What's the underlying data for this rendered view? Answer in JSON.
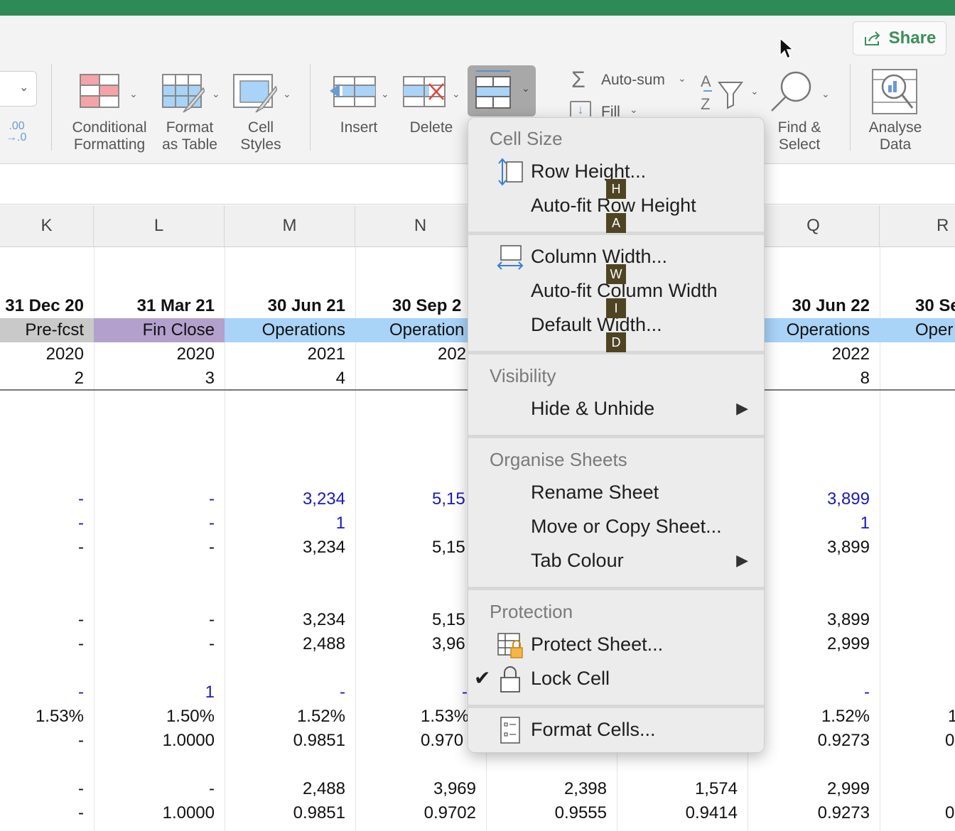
{
  "share": {
    "label": "Share"
  },
  "ribbon": {
    "decimal_label": ".00\n→.0",
    "conditional_formatting": "Conditional\nFormatting",
    "format_as_table": "Format\nas Table",
    "cell_styles": "Cell\nStyles",
    "insert": "Insert",
    "delete": "Delete",
    "autosum": "Auto-sum",
    "fill": "Fill",
    "find_select": "Find &\nSelect",
    "analyse_data": "Analyse\nData"
  },
  "columns": {
    "k": "K",
    "l": "L",
    "m": "M",
    "n": "N",
    "q": "Q",
    "r": "R"
  },
  "sheet": {
    "row_dates": [
      "31 Dec 20",
      "31 Mar 21",
      "30 Jun 21",
      "30 Sep 2",
      "30 Jun 22",
      "30 Se"
    ],
    "row_phase": [
      "Pre-fcst",
      "Fin Close",
      "Operations",
      "Operation",
      "Operations",
      "Oper"
    ],
    "row_year": [
      "2020",
      "2020",
      "2021",
      "202",
      "2022"
    ],
    "row_num": [
      "2",
      "3",
      "4",
      "8"
    ],
    "r1": [
      "-",
      "-",
      "3,234",
      "5,15",
      "3,899"
    ],
    "r2": [
      "-",
      "-",
      "1",
      "1"
    ],
    "r3": [
      "-",
      "-",
      "3,234",
      "5,15",
      "3,899"
    ],
    "r4": [
      "-",
      "-",
      "3,234",
      "5,15",
      "3,899"
    ],
    "r5": [
      "-",
      "-",
      "2,488",
      "3,96",
      "2,999"
    ],
    "r6": [
      "-",
      "1",
      "-",
      "-",
      "-"
    ],
    "r7": [
      "1.53%",
      "1.50%",
      "1.52%",
      "1.53%",
      "1.52%",
      "1"
    ],
    "r8": [
      "-",
      "1.0000",
      "0.9851",
      "0.970",
      "0.9273",
      "0"
    ],
    "r9": [
      "-",
      "-",
      "2,488",
      "3,969",
      "2,398",
      "1,574",
      "2,999"
    ],
    "r10": [
      "-",
      "1.0000",
      "0.9851",
      "0.9702",
      "0.9555",
      "0.9414",
      "0.9273",
      "0"
    ]
  },
  "menu": {
    "cell_size": "Cell Size",
    "row_height": "Row Height...",
    "autofit_row": "Auto-fit Row Height",
    "column_width": "Column Width...",
    "autofit_col": "Auto-fit Column Width",
    "default_width": "Default Width...",
    "visibility": "Visibility",
    "hide_unhide": "Hide & Unhide",
    "organise": "Organise Sheets",
    "rename": "Rename Sheet",
    "move_copy": "Move or Copy Sheet...",
    "tab_colour": "Tab Colour",
    "protection": "Protection",
    "protect_sheet": "Protect Sheet...",
    "lock_cell": "Lock Cell",
    "format_cells": "Format Cells...",
    "keys": [
      "H",
      "A",
      "W",
      "I",
      "D"
    ]
  }
}
